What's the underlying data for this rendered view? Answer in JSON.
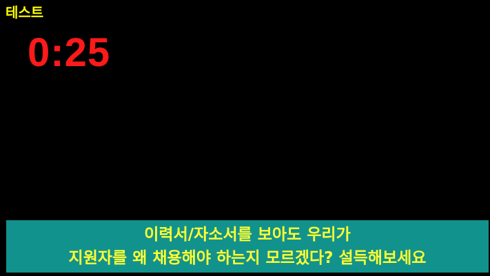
{
  "label": "테스트",
  "timer": "0:25",
  "caption": {
    "line1": "이력서/자소서를 보아도 우리가",
    "line2": "지원자를 왜 채용해야 하는지 모르겠다? 설득해보세요"
  },
  "colors": {
    "background": "#000000",
    "label": "#ffff00",
    "timer": "#ff1a1a",
    "caption_bg": "#12928c",
    "caption_text": "#ffff33"
  }
}
